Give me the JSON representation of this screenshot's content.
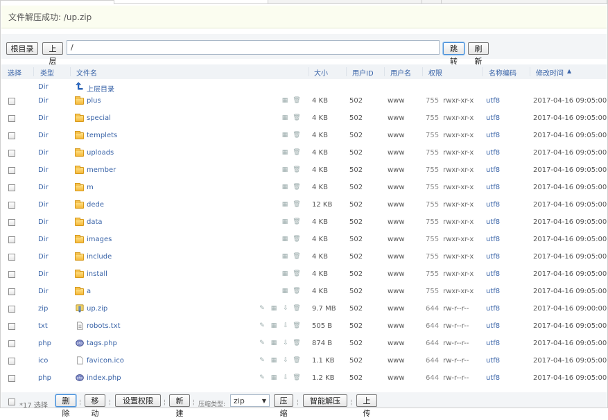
{
  "notice": "文件解压成功: /up.zip",
  "toolbar": {
    "root_btn": "根目录",
    "up_btn": "上层",
    "path_value": "/",
    "go_btn": "跳转",
    "refresh_btn": "刷新"
  },
  "columns": {
    "select": "选择",
    "type": "类型",
    "name": "文件名",
    "size": "大小",
    "uid": "用户ID",
    "user": "用户名",
    "perm": "权限",
    "encoding": "名称编码",
    "mtime": "修改时间",
    "sort_arrow": "▲"
  },
  "parent_row": {
    "type": "Dir",
    "name": "上层目录"
  },
  "rows": [
    {
      "type": "Dir",
      "name": "plus",
      "size": "4 KB",
      "uid": "502",
      "user": "www",
      "mode": "755",
      "perm": "rwxr-xr-x",
      "enc": "utf8",
      "mtime": "2017-04-16 09:05:00",
      "icon": "folder"
    },
    {
      "type": "Dir",
      "name": "special",
      "size": "4 KB",
      "uid": "502",
      "user": "www",
      "mode": "755",
      "perm": "rwxr-xr-x",
      "enc": "utf8",
      "mtime": "2017-04-16 09:05:00",
      "icon": "folder"
    },
    {
      "type": "Dir",
      "name": "templets",
      "size": "4 KB",
      "uid": "502",
      "user": "www",
      "mode": "755",
      "perm": "rwxr-xr-x",
      "enc": "utf8",
      "mtime": "2017-04-16 09:05:00",
      "icon": "folder"
    },
    {
      "type": "Dir",
      "name": "uploads",
      "size": "4 KB",
      "uid": "502",
      "user": "www",
      "mode": "755",
      "perm": "rwxr-xr-x",
      "enc": "utf8",
      "mtime": "2017-04-16 09:05:00",
      "icon": "folder"
    },
    {
      "type": "Dir",
      "name": "member",
      "size": "4 KB",
      "uid": "502",
      "user": "www",
      "mode": "755",
      "perm": "rwxr-xr-x",
      "enc": "utf8",
      "mtime": "2017-04-16 09:05:00",
      "icon": "folder"
    },
    {
      "type": "Dir",
      "name": "m",
      "size": "4 KB",
      "uid": "502",
      "user": "www",
      "mode": "755",
      "perm": "rwxr-xr-x",
      "enc": "utf8",
      "mtime": "2017-04-16 09:05:00",
      "icon": "folder"
    },
    {
      "type": "Dir",
      "name": "dede",
      "size": "12 KB",
      "uid": "502",
      "user": "www",
      "mode": "755",
      "perm": "rwxr-xr-x",
      "enc": "utf8",
      "mtime": "2017-04-16 09:05:00",
      "icon": "folder"
    },
    {
      "type": "Dir",
      "name": "data",
      "size": "4 KB",
      "uid": "502",
      "user": "www",
      "mode": "755",
      "perm": "rwxr-xr-x",
      "enc": "utf8",
      "mtime": "2017-04-16 09:05:00",
      "icon": "folder"
    },
    {
      "type": "Dir",
      "name": "images",
      "size": "4 KB",
      "uid": "502",
      "user": "www",
      "mode": "755",
      "perm": "rwxr-xr-x",
      "enc": "utf8",
      "mtime": "2017-04-16 09:05:00",
      "icon": "folder"
    },
    {
      "type": "Dir",
      "name": "include",
      "size": "4 KB",
      "uid": "502",
      "user": "www",
      "mode": "755",
      "perm": "rwxr-xr-x",
      "enc": "utf8",
      "mtime": "2017-04-16 09:05:00",
      "icon": "folder"
    },
    {
      "type": "Dir",
      "name": "install",
      "size": "4 KB",
      "uid": "502",
      "user": "www",
      "mode": "755",
      "perm": "rwxr-xr-x",
      "enc": "utf8",
      "mtime": "2017-04-16 09:05:00",
      "icon": "folder"
    },
    {
      "type": "Dir",
      "name": "a",
      "size": "4 KB",
      "uid": "502",
      "user": "www",
      "mode": "755",
      "perm": "rwxr-xr-x",
      "enc": "utf8",
      "mtime": "2017-04-16 09:05:00",
      "icon": "folder"
    },
    {
      "type": "zip",
      "name": "up.zip",
      "size": "9.7 MB",
      "uid": "502",
      "user": "www",
      "mode": "644",
      "perm": "rw-r--r--",
      "enc": "utf8",
      "mtime": "2017-04-16 09:00:00",
      "icon": "zip"
    },
    {
      "type": "txt",
      "name": "robots.txt",
      "size": "505 B",
      "uid": "502",
      "user": "www",
      "mode": "644",
      "perm": "rw-r--r--",
      "enc": "utf8",
      "mtime": "2017-04-16 09:05:00",
      "icon": "txt"
    },
    {
      "type": "php",
      "name": "tags.php",
      "size": "874 B",
      "uid": "502",
      "user": "www",
      "mode": "644",
      "perm": "rw-r--r--",
      "enc": "utf8",
      "mtime": "2017-04-16 09:05:00",
      "icon": "php"
    },
    {
      "type": "ico",
      "name": "favicon.ico",
      "size": "1.1 KB",
      "uid": "502",
      "user": "www",
      "mode": "644",
      "perm": "rw-r--r--",
      "enc": "utf8",
      "mtime": "2017-04-16 09:05:00",
      "icon": "ico"
    },
    {
      "type": "php",
      "name": "index.php",
      "size": "1.2 KB",
      "uid": "502",
      "user": "www",
      "mode": "644",
      "perm": "rw-r--r--",
      "enc": "utf8",
      "mtime": "2017-04-16 09:05:00",
      "icon": "php"
    }
  ],
  "footer": {
    "select_count": "*17 选择",
    "delete_btn": "删除",
    "move_btn": "移动",
    "perm_btn": "设置权限",
    "new_btn": "新建",
    "compress_type_label": "压缩类型:",
    "compress_type_value": "zip",
    "compress_btn": "压缩",
    "extract_btn": "智能解压",
    "upload_btn": "上传"
  },
  "colors": {
    "accent": "#3a64a8",
    "header_bg": "#f0f3f6",
    "notice_bg": "#fbfdf0"
  }
}
